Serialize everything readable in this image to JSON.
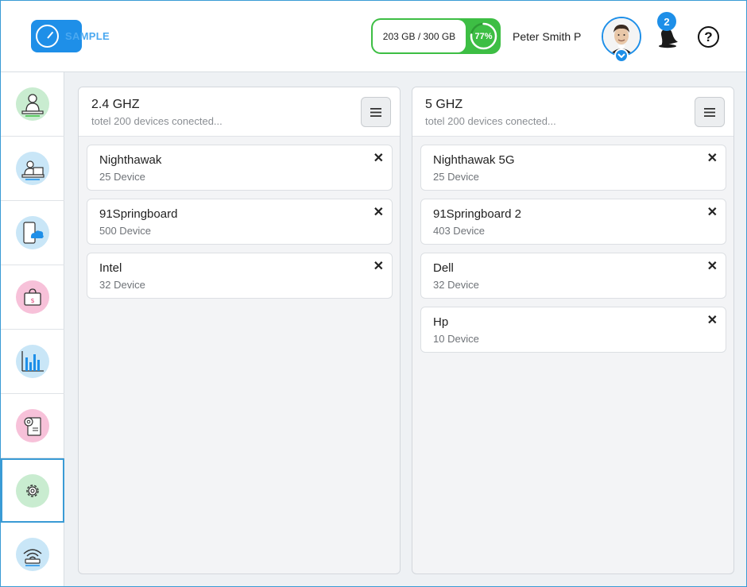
{
  "header": {
    "logo_text": "SAMPLE",
    "storage_label": "203 GB / 300 GB",
    "storage_percent": "77%",
    "storage_fraction": 0.77,
    "username": "Peter Smith P",
    "notification_count": "2",
    "help_label": "?"
  },
  "sidebar": {
    "items": [
      {
        "icon": "user-laptop-icon",
        "color": "#c9ecd0"
      },
      {
        "icon": "users-laptop-icon",
        "color": "#c9e6f7"
      },
      {
        "icon": "mobile-cloud-icon",
        "color": "#c9e6f7"
      },
      {
        "icon": "shopping-bag-icon",
        "color": "#f7c1d9"
      },
      {
        "icon": "bar-chart-icon",
        "color": "#c9e6f7"
      },
      {
        "icon": "settings-document-icon",
        "color": "#f7c1d9"
      },
      {
        "icon": "gear-icon",
        "color": "#c9ecd0",
        "active": true
      },
      {
        "icon": "wifi-router-icon",
        "color": "#c9e6f7"
      }
    ]
  },
  "panels": [
    {
      "title": "2.4 GHZ",
      "subtitle": "totel 200 devices conected...",
      "networks": [
        {
          "name": "Nighthawak",
          "count": "25 Device"
        },
        {
          "name": "91Springboard",
          "count": "500 Device"
        },
        {
          "name": "Intel",
          "count": "32 Device"
        }
      ]
    },
    {
      "title": "5 GHZ",
      "subtitle": "totel 200 devices conected...",
      "networks": [
        {
          "name": "Nighthawak 5G",
          "count": "25 Device"
        },
        {
          "name": "91Springboard 2",
          "count": "403 Device"
        },
        {
          "name": "Dell",
          "count": "32 Device"
        },
        {
          "name": "Hp",
          "count": "10 Device"
        }
      ]
    }
  ],
  "close_glyph": "✕",
  "colors": {
    "accent": "#1e8fe8",
    "storage_green": "#3dbe44",
    "active_border": "#3a9bd5"
  }
}
